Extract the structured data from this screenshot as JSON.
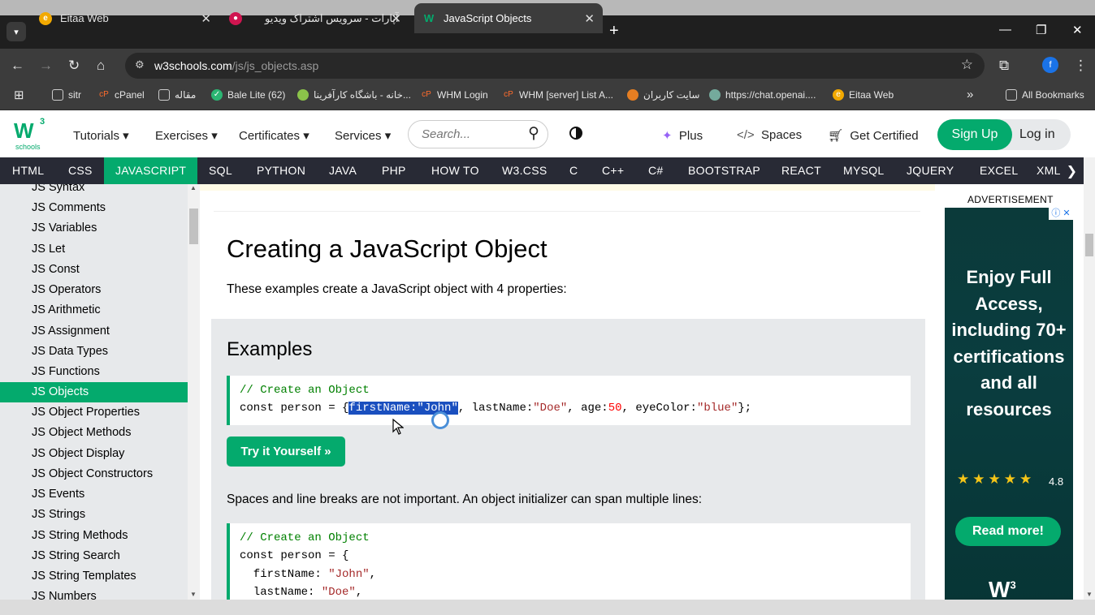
{
  "browser": {
    "tabs": [
      {
        "title": "Eitaa Web",
        "icon": "eitaa-icon"
      },
      {
        "title": "آپارات - سرویس اشتراک ویدیو",
        "icon": "aparat-icon"
      },
      {
        "title": "JavaScript Objects",
        "icon": "w3schools-icon",
        "active": true
      }
    ],
    "url_host": "w3schools.com",
    "url_path": "/js/js_objects.asp",
    "profile_initial": "f",
    "bookmarks": [
      "sitr",
      "cPanel",
      "مقاله",
      "Bale Lite (62)",
      "خانه - باشگاه کارآفرینا...",
      "WHM Login",
      "WHM [server] List A...",
      "سایت کاربران",
      "https://chat.openai....",
      "Eitaa Web"
    ],
    "all_bookmarks": "All Bookmarks"
  },
  "site": {
    "logo": "W",
    "logo_sup": "3",
    "logo_sub": "schools",
    "menu": [
      "Tutorials",
      "Exercises",
      "Certificates",
      "Services"
    ],
    "search_placeholder": "Search...",
    "plus": "Plus",
    "spaces": "Spaces",
    "get_certified": "Get Certified",
    "sign_up": "Sign Up",
    "log_in": "Log in",
    "accent": "#04aa6d",
    "languages": [
      "HTML",
      "CSS",
      "JAVASCRIPT",
      "SQL",
      "PYTHON",
      "JAVA",
      "PHP",
      "HOW TO",
      "W3.CSS",
      "C",
      "C++",
      "C#",
      "BOOTSTRAP",
      "REACT",
      "MYSQL",
      "JQUERY",
      "EXCEL",
      "XML"
    ],
    "active_language": "JAVASCRIPT"
  },
  "sidebar": {
    "items": [
      "JS Syntax",
      "JS Comments",
      "JS Variables",
      "JS Let",
      "JS Const",
      "JS Operators",
      "JS Arithmetic",
      "JS Assignment",
      "JS Data Types",
      "JS Functions",
      "JS Objects",
      "JS Object Properties",
      "JS Object Methods",
      "JS Object Display",
      "JS Object Constructors",
      "JS Events",
      "JS Strings",
      "JS String Methods",
      "JS String Search",
      "JS String Templates",
      "JS Numbers"
    ],
    "active": "JS Objects"
  },
  "main": {
    "title": "Creating a JavaScript Object",
    "intro": "These examples create a JavaScript object with 4 properties:",
    "examples_heading": "Examples",
    "code1_comment": "// Create an Object",
    "code1_pre": "const person = {",
    "code1_sel": "firstName:\"John\"",
    "code1_mid1": ", lastName:",
    "code1_str1": "\"Doe\"",
    "code1_mid2": ", age:",
    "code1_num": "50",
    "code1_mid3": ", eyeColor:",
    "code1_str2": "\"blue\"",
    "code1_end": "};",
    "try_button": "Try it Yourself »",
    "spaces_text": "Spaces and line breaks are not important. An object initializer can span multiple lines:",
    "code2_comment": "// Create an Object",
    "code2_line1": "const person = {",
    "code2_key1": "  firstName: ",
    "code2_val1": "\"John\"",
    "code2_key2": "  lastName: ",
    "code2_val2": "\"Doe\""
  },
  "ad": {
    "label": "ADVERTISEMENT",
    "text": "Enjoy Full Access, including 70+ certifications and all resources",
    "stars": "★★★★★",
    "rating": "4.8",
    "read_more": "Read more!"
  }
}
